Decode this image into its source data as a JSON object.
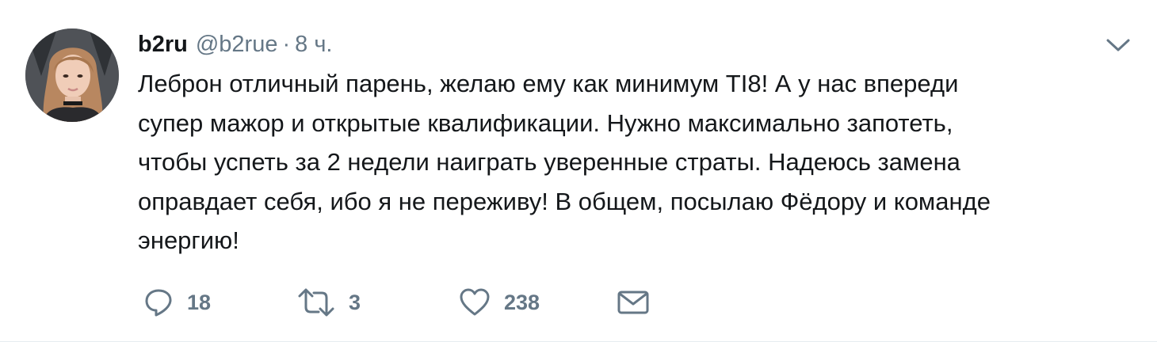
{
  "tweet": {
    "author_name": "b2ru",
    "author_handle": "@b2rue",
    "separator": "·",
    "time": "8 ч.",
    "text": "Леброн отличный парень, желаю ему как минимум TI8! А у нас впереди\nсупер мажор и открытые квалификации. Нужно максимально запотеть,\nчтобы успеть за 2 недели наиграть уверенные страты. Надеюсь замена\nоправдает себя, ибо я не переживу! В общем, посылаю Фёдору и команде\nэнергию!",
    "reply_count": "18",
    "retweet_count": "3",
    "like_count": "238"
  },
  "icons": {
    "avatar": "avatar-photo",
    "caret": "chevron-down-icon",
    "reply": "reply-icon",
    "retweet": "retweet-icon",
    "like": "heart-icon",
    "dm": "envelope-icon"
  },
  "colors": {
    "text": "#14171a",
    "secondary": "#657786",
    "icon": "#657786",
    "divider": "#e6ecf0"
  }
}
